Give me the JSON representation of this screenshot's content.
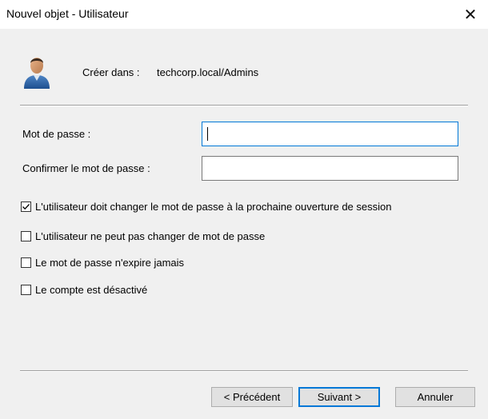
{
  "window": {
    "title": "Nouvel objet - Utilisateur",
    "close_glyph": "✕"
  },
  "header": {
    "icon": "user-icon",
    "create_in_label": "Créer dans :",
    "create_in_value": "techcorp.local/Admins"
  },
  "form": {
    "password_label": "Mot de passe :",
    "password_value": "",
    "confirm_label": "Confirmer le mot de passe :",
    "confirm_value": ""
  },
  "options": [
    {
      "label": "L'utilisateur doit changer le mot de passe à la prochaine ouverture de session",
      "checked": true
    },
    {
      "label": "L'utilisateur ne peut pas changer de mot de passe",
      "checked": false
    },
    {
      "label": "Le mot de passe n'expire jamais",
      "checked": false
    },
    {
      "label": "Le compte est désactivé",
      "checked": false
    }
  ],
  "buttons": {
    "back": "< Précédent",
    "next": "Suivant >",
    "cancel": "Annuler"
  },
  "colors": {
    "accent": "#0078d7",
    "background": "#f0f0f0"
  }
}
